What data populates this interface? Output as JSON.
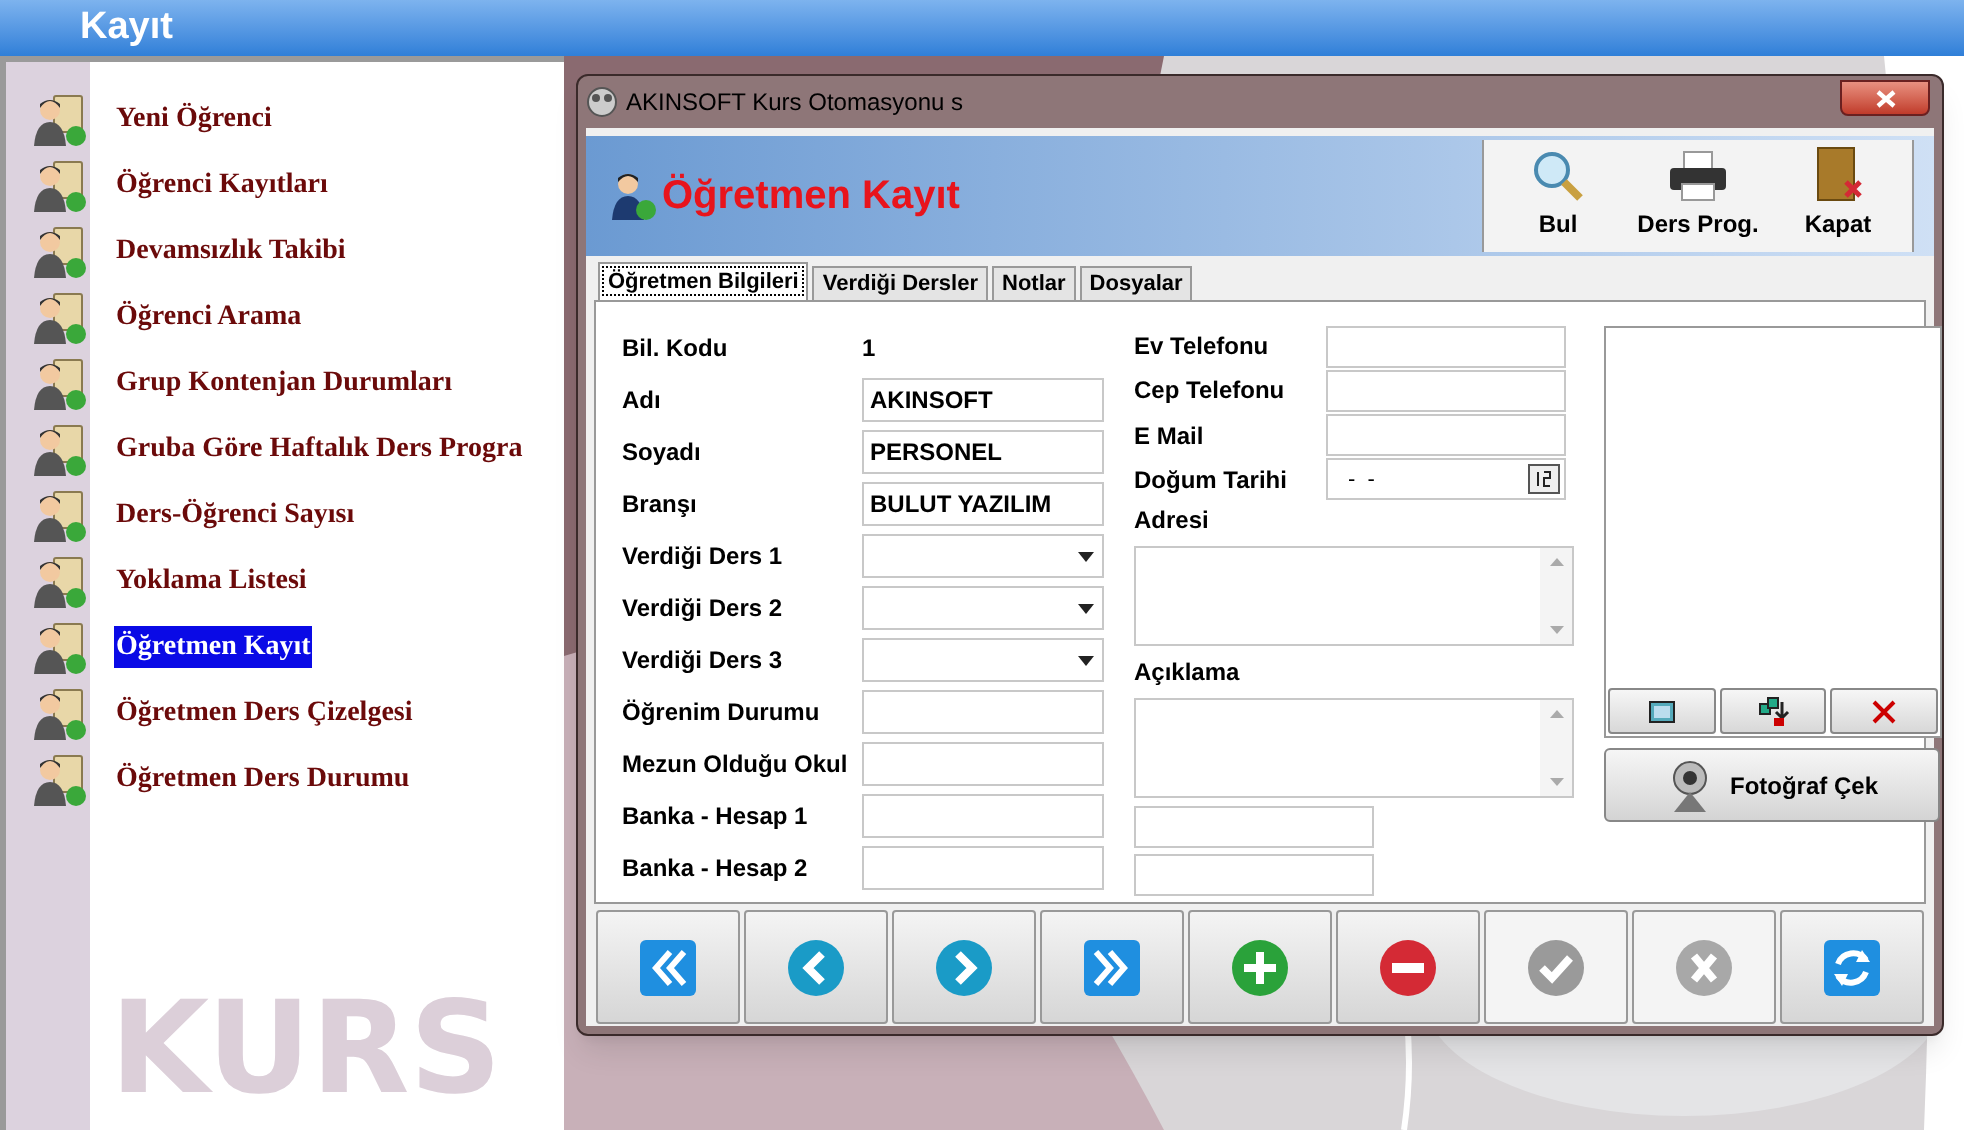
{
  "header": {
    "title": "Kayıt"
  },
  "menu": [
    {
      "label": "Yeni Öğrenci",
      "selected": false
    },
    {
      "label": "Öğrenci Kayıtları",
      "selected": false
    },
    {
      "label": "Devamsızlık Takibi",
      "selected": false
    },
    {
      "label": "Öğrenci Arama",
      "selected": false
    },
    {
      "label": "Grup Kontenjan Durumları",
      "selected": false
    },
    {
      "label": "Gruba Göre Haftalık Ders Progra",
      "selected": false
    },
    {
      "label": "Ders-Öğrenci Sayısı",
      "selected": false
    },
    {
      "label": "Yoklama Listesi",
      "selected": false
    },
    {
      "label": "Öğretmen Kayıt",
      "selected": true
    },
    {
      "label": "Öğretmen Ders Çizelgesi",
      "selected": false
    },
    {
      "label": "Öğretmen Ders Durumu",
      "selected": false
    }
  ],
  "brand_text": "KURS",
  "dialog": {
    "title": "AKINSOFT Kurs Otomasyonu s",
    "heading": "Öğretmen Kayıt",
    "toolbar": [
      {
        "label": "Bul",
        "kind": "search"
      },
      {
        "label": "Ders Prog.",
        "kind": "print"
      },
      {
        "label": "Kapat",
        "kind": "exit"
      }
    ],
    "tabs": [
      {
        "label": "Öğretmen Bilgileri",
        "selected": true
      },
      {
        "label": "Verdiği Dersler",
        "selected": false
      },
      {
        "label": "Notlar",
        "selected": false
      },
      {
        "label": "Dosyalar",
        "selected": false
      }
    ],
    "form_left": [
      {
        "label": "Bil. Kodu",
        "kind": "readonly",
        "value": "1"
      },
      {
        "label": "Adı",
        "kind": "text",
        "value": "AKINSOFT"
      },
      {
        "label": "Soyadı",
        "kind": "text",
        "value": "PERSONEL"
      },
      {
        "label": "Branşı",
        "kind": "text",
        "value": "BULUT YAZILIM"
      },
      {
        "label": "Verdiği Ders 1",
        "kind": "select"
      },
      {
        "label": "Verdiği Ders 2",
        "kind": "select"
      },
      {
        "label": "Verdiği Ders 3",
        "kind": "select"
      },
      {
        "label": "Öğrenim Durumu",
        "kind": "text"
      },
      {
        "label": "Mezun Olduğu Okul",
        "kind": "text"
      },
      {
        "label": "Banka - Hesap 1",
        "kind": "text"
      },
      {
        "label": "Banka - Hesap 2",
        "kind": "text"
      }
    ],
    "form_right": [
      {
        "label": "Ev Telefonu",
        "kind": "field"
      },
      {
        "label": "Cep Telefonu",
        "kind": "field"
      },
      {
        "label": "E Mail",
        "kind": "field"
      },
      {
        "label": "Doğum Tarihi",
        "kind": "date",
        "value": "-  -"
      },
      {
        "label": "Adresi",
        "kind": "textarea"
      },
      {
        "label": "Açıklama",
        "kind": "textarea"
      },
      {
        "kind": "bare"
      },
      {
        "kind": "bare"
      }
    ],
    "photo_buttons": [
      {
        "kind": "view"
      },
      {
        "kind": "load"
      },
      {
        "kind": "delete"
      }
    ],
    "photo_capture": "Fotoğraf Çek",
    "nav_buttons": [
      {
        "kind": "first",
        "disabled": false
      },
      {
        "kind": "prev",
        "disabled": false
      },
      {
        "kind": "next",
        "disabled": false
      },
      {
        "kind": "last",
        "disabled": false
      },
      {
        "kind": "add",
        "disabled": false
      },
      {
        "kind": "remove",
        "disabled": false
      },
      {
        "kind": "save",
        "disabled": true
      },
      {
        "kind": "cancel",
        "disabled": true
      },
      {
        "kind": "refresh",
        "disabled": false
      }
    ]
  }
}
